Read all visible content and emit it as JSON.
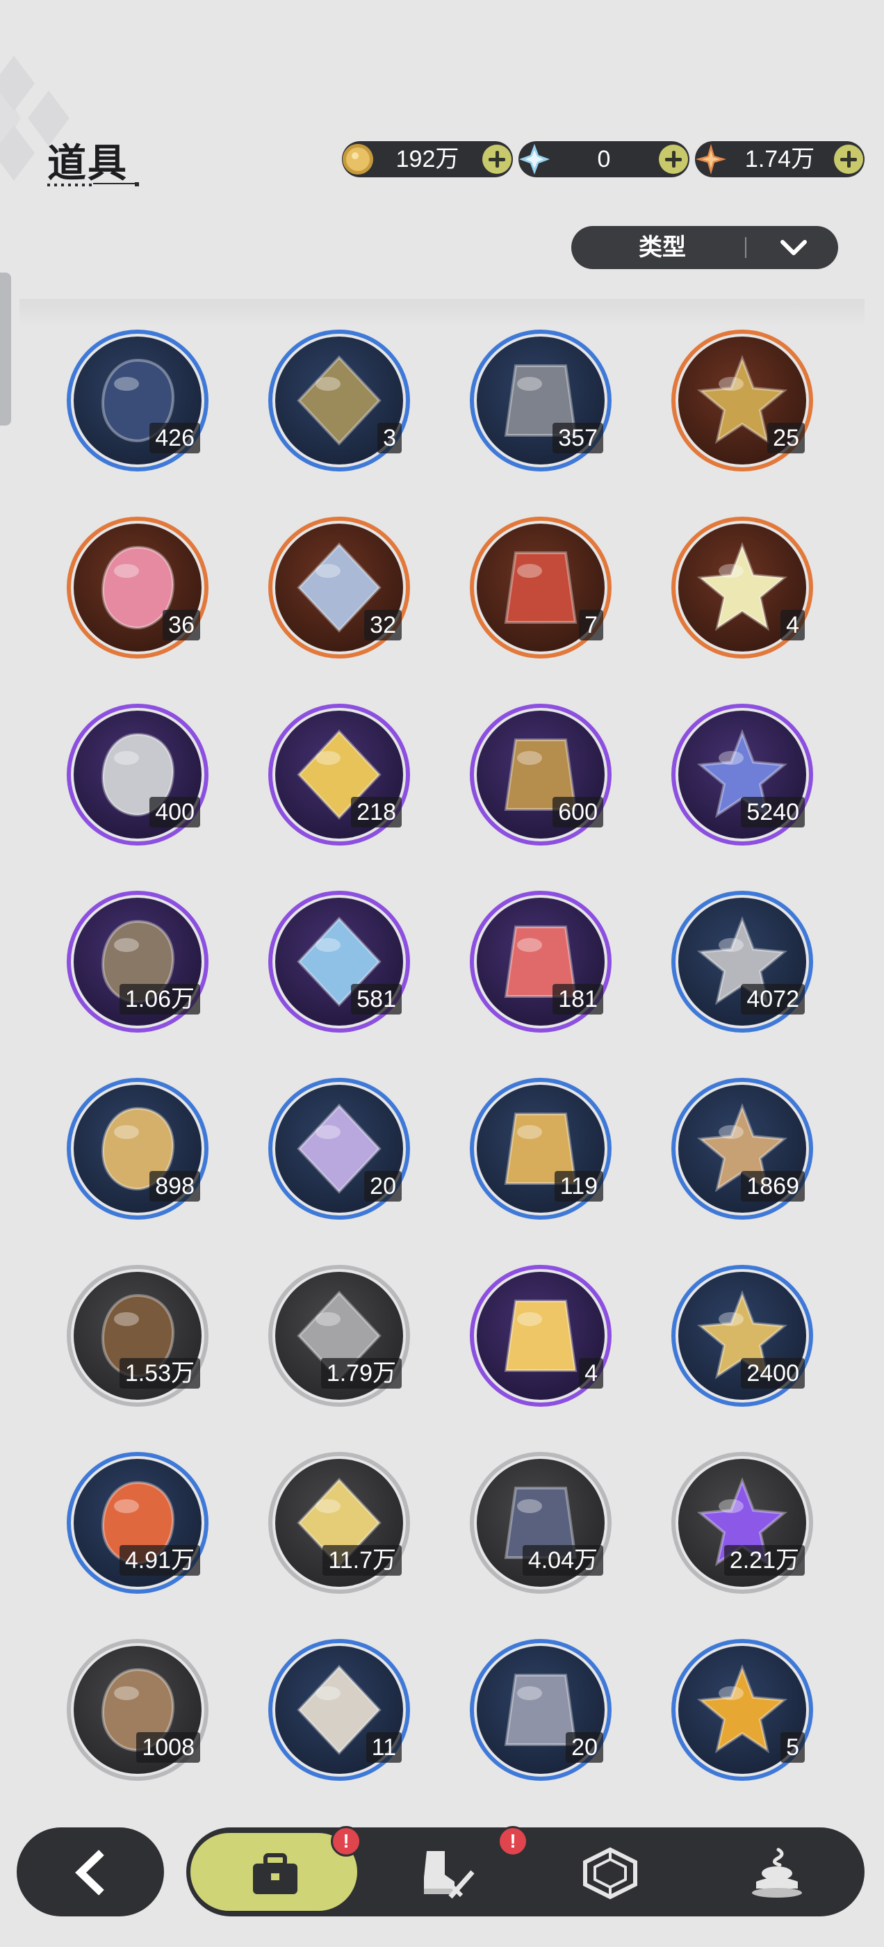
{
  "header": {
    "title": "道具",
    "currencies": [
      {
        "icon": "gold-coin-icon",
        "value": "192万"
      },
      {
        "icon": "crystal-icon",
        "value": "0"
      },
      {
        "icon": "star-shard-icon",
        "value": "1.74万"
      }
    ],
    "filter_label": "类型"
  },
  "colors": {
    "blue": "#3f79d8",
    "orange": "#e2783a",
    "purple": "#8c4fe0",
    "gray": "#b9b9bc",
    "nav_active": "#cfd477",
    "badge": "#e0444c"
  },
  "items": [
    {
      "icon": "boxing-glove-icon",
      "rarity": "blue",
      "count": "426"
    },
    {
      "icon": "pickaxe-icon",
      "rarity": "blue",
      "count": "3"
    },
    {
      "icon": "hammer-icon",
      "rarity": "blue",
      "count": "357"
    },
    {
      "icon": "compass-emblem-icon",
      "rarity": "orange",
      "count": "25"
    },
    {
      "icon": "pink-gem-heart-icon",
      "rarity": "orange",
      "count": "36"
    },
    {
      "icon": "outfit-token-icon",
      "rarity": "orange",
      "count": "32"
    },
    {
      "icon": "wheel-ticket-icon",
      "rarity": "orange",
      "count": "7"
    },
    {
      "icon": "puzzle-ticket-icon",
      "rarity": "orange",
      "count": "4"
    },
    {
      "icon": "scissors-coin-icon",
      "rarity": "purple",
      "count": "400"
    },
    {
      "icon": "gold-ingot-icon",
      "rarity": "purple",
      "count": "218"
    },
    {
      "icon": "medal-icon",
      "rarity": "purple",
      "count": "600"
    },
    {
      "icon": "star-moon-coin-icon",
      "rarity": "purple",
      "count": "5240"
    },
    {
      "icon": "fist-coin-icon",
      "rarity": "purple",
      "count": "1.06万"
    },
    {
      "icon": "shield-coin-icon",
      "rarity": "purple",
      "count": "581"
    },
    {
      "icon": "heart-coin-icon",
      "rarity": "purple",
      "count": "181"
    },
    {
      "icon": "silver-star-coin-icon",
      "rarity": "blue",
      "count": "4072"
    },
    {
      "icon": "dagger-icon",
      "rarity": "blue",
      "count": "898"
    },
    {
      "icon": "scale-fragment-icon",
      "rarity": "blue",
      "count": "20"
    },
    {
      "icon": "gear-icon",
      "rarity": "blue",
      "count": "119"
    },
    {
      "icon": "leaf-icon",
      "rarity": "blue",
      "count": "1869"
    },
    {
      "icon": "wood-logs-icon",
      "rarity": "gray",
      "count": "1.53万"
    },
    {
      "icon": "stone-bricks-icon",
      "rarity": "gray",
      "count": "1.79万"
    },
    {
      "icon": "gold-crystal-icon",
      "rarity": "purple",
      "count": "4"
    },
    {
      "icon": "gold-sand-icon",
      "rarity": "blue",
      "count": "2400"
    },
    {
      "icon": "red-crystal-icon",
      "rarity": "blue",
      "count": "4.91万"
    },
    {
      "icon": "sand-pile-icon",
      "rarity": "gray",
      "count": "11.7万"
    },
    {
      "icon": "dark-crystal-icon",
      "rarity": "gray",
      "count": "4.04万"
    },
    {
      "icon": "purple-orb-icon",
      "rarity": "gray",
      "count": "2.21万"
    },
    {
      "icon": "seed-bag-icon",
      "rarity": "gray",
      "count": "1008"
    },
    {
      "icon": "egg-icon",
      "rarity": "blue",
      "count": "11"
    },
    {
      "icon": "feather-bundle-icon",
      "rarity": "blue",
      "count": "20"
    },
    {
      "icon": "potion-vial-icon",
      "rarity": "blue",
      "count": "5"
    }
  ],
  "nav": {
    "back_icon": "chevron-left-icon",
    "tabs": [
      {
        "icon": "bag-icon",
        "active": true,
        "badge": "!"
      },
      {
        "icon": "boot-sword-icon",
        "active": false,
        "badge": "!"
      },
      {
        "icon": "hexagon-gem-icon",
        "active": false,
        "badge": ""
      },
      {
        "icon": "cake-icon",
        "active": false,
        "badge": ""
      }
    ]
  }
}
